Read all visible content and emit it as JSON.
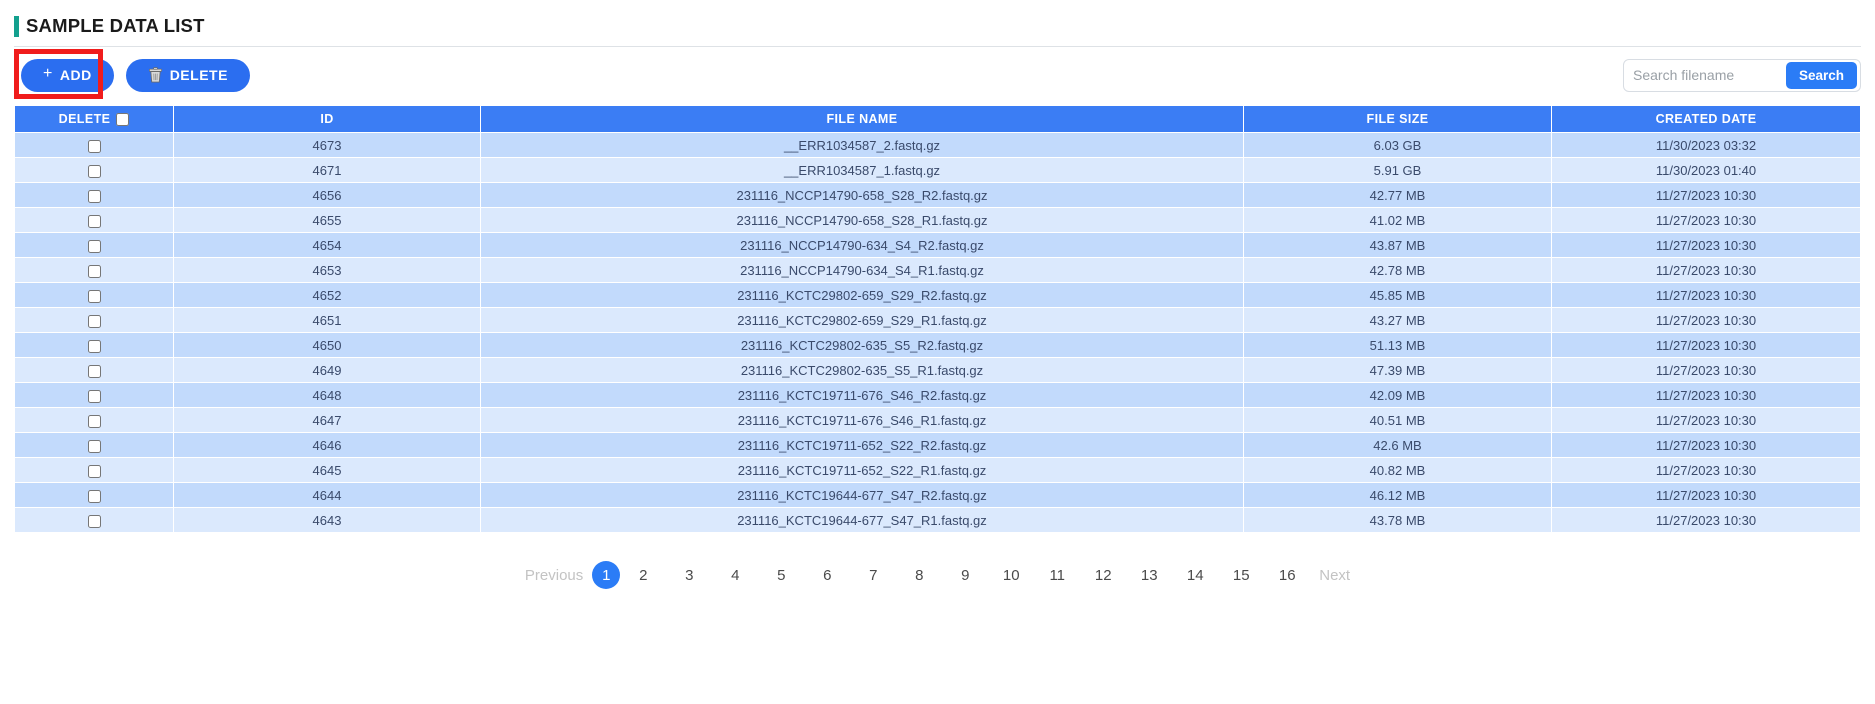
{
  "page": {
    "title": "SAMPLE DATA LIST",
    "accent_color": "#13a08e"
  },
  "toolbar": {
    "add_label": "ADD",
    "add_icon": "plus-icon",
    "delete_label": "DELETE",
    "delete_icon": "trash-icon",
    "button_color": "#2b6ef0",
    "annotation_color": "#f01c1c"
  },
  "search": {
    "placeholder": "Search filename",
    "value": "",
    "button_label": "Search",
    "button_color": "#2b7cf6"
  },
  "table": {
    "header_color": "#3b7df4",
    "row_odd_color": "#c2dafc",
    "row_even_color": "#dbe9fd",
    "columns": [
      {
        "key": "delete",
        "label": "DELETE",
        "has_select_all_checkbox": true
      },
      {
        "key": "id",
        "label": "ID"
      },
      {
        "key": "file_name",
        "label": "FILE NAME"
      },
      {
        "key": "file_size",
        "label": "FILE SIZE"
      },
      {
        "key": "created_date",
        "label": "CREATED DATE"
      }
    ],
    "select_all_checked": false,
    "rows": [
      {
        "checked": false,
        "id": "4673",
        "file_name": "__ERR1034587_2.fastq.gz",
        "file_size": "6.03 GB",
        "created_date": "11/30/2023 03:32"
      },
      {
        "checked": false,
        "id": "4671",
        "file_name": "__ERR1034587_1.fastq.gz",
        "file_size": "5.91 GB",
        "created_date": "11/30/2023 01:40"
      },
      {
        "checked": false,
        "id": "4656",
        "file_name": "231116_NCCP14790-658_S28_R2.fastq.gz",
        "file_size": "42.77 MB",
        "created_date": "11/27/2023 10:30"
      },
      {
        "checked": false,
        "id": "4655",
        "file_name": "231116_NCCP14790-658_S28_R1.fastq.gz",
        "file_size": "41.02 MB",
        "created_date": "11/27/2023 10:30"
      },
      {
        "checked": false,
        "id": "4654",
        "file_name": "231116_NCCP14790-634_S4_R2.fastq.gz",
        "file_size": "43.87 MB",
        "created_date": "11/27/2023 10:30"
      },
      {
        "checked": false,
        "id": "4653",
        "file_name": "231116_NCCP14790-634_S4_R1.fastq.gz",
        "file_size": "42.78 MB",
        "created_date": "11/27/2023 10:30"
      },
      {
        "checked": false,
        "id": "4652",
        "file_name": "231116_KCTC29802-659_S29_R2.fastq.gz",
        "file_size": "45.85 MB",
        "created_date": "11/27/2023 10:30"
      },
      {
        "checked": false,
        "id": "4651",
        "file_name": "231116_KCTC29802-659_S29_R1.fastq.gz",
        "file_size": "43.27 MB",
        "created_date": "11/27/2023 10:30"
      },
      {
        "checked": false,
        "id": "4650",
        "file_name": "231116_KCTC29802-635_S5_R2.fastq.gz",
        "file_size": "51.13 MB",
        "created_date": "11/27/2023 10:30"
      },
      {
        "checked": false,
        "id": "4649",
        "file_name": "231116_KCTC29802-635_S5_R1.fastq.gz",
        "file_size": "47.39 MB",
        "created_date": "11/27/2023 10:30"
      },
      {
        "checked": false,
        "id": "4648",
        "file_name": "231116_KCTC19711-676_S46_R2.fastq.gz",
        "file_size": "42.09 MB",
        "created_date": "11/27/2023 10:30"
      },
      {
        "checked": false,
        "id": "4647",
        "file_name": "231116_KCTC19711-676_S46_R1.fastq.gz",
        "file_size": "40.51 MB",
        "created_date": "11/27/2023 10:30"
      },
      {
        "checked": false,
        "id": "4646",
        "file_name": "231116_KCTC19711-652_S22_R2.fastq.gz",
        "file_size": "42.6 MB",
        "created_date": "11/27/2023 10:30"
      },
      {
        "checked": false,
        "id": "4645",
        "file_name": "231116_KCTC19711-652_S22_R1.fastq.gz",
        "file_size": "40.82 MB",
        "created_date": "11/27/2023 10:30"
      },
      {
        "checked": false,
        "id": "4644",
        "file_name": "231116_KCTC19644-677_S47_R2.fastq.gz",
        "file_size": "46.12 MB",
        "created_date": "11/27/2023 10:30"
      },
      {
        "checked": false,
        "id": "4643",
        "file_name": "231116_KCTC19644-677_S47_R1.fastq.gz",
        "file_size": "43.78 MB",
        "created_date": "11/27/2023 10:30"
      }
    ]
  },
  "pagination": {
    "previous_label": "Previous",
    "next_label": "Next",
    "previous_disabled": true,
    "next_disabled": true,
    "pages": [
      "1",
      "2",
      "3",
      "4",
      "5",
      "6",
      "7",
      "8",
      "9",
      "10",
      "11",
      "12",
      "13",
      "14",
      "15",
      "16"
    ],
    "active_page": "1",
    "active_color": "#2b7cf6"
  }
}
